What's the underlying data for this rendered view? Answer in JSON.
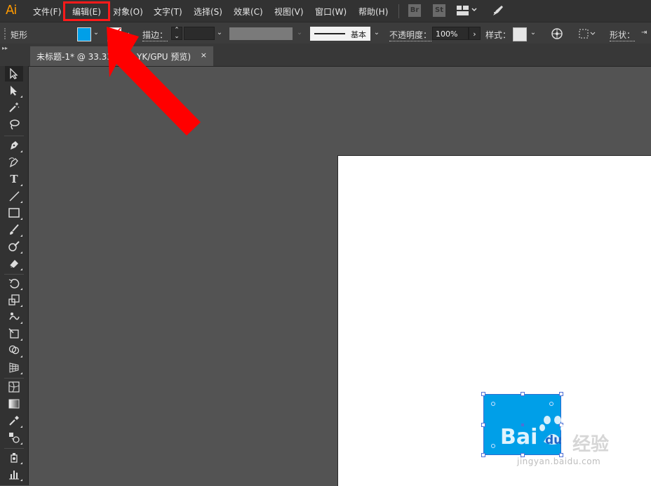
{
  "menubar": {
    "app_logo": "Ai",
    "items": [
      {
        "label": "文件(F)"
      },
      {
        "label": "编辑(E)"
      },
      {
        "label": "对象(O)"
      },
      {
        "label": "文字(T)"
      },
      {
        "label": "选择(S)"
      },
      {
        "label": "效果(C)"
      },
      {
        "label": "视图(V)"
      },
      {
        "label": "窗口(W)"
      },
      {
        "label": "帮助(H)"
      }
    ],
    "icons": {
      "bridge": "Br",
      "stock": "St"
    }
  },
  "control_bar": {
    "selection_type": "矩形",
    "fill_color": "#009fe8",
    "stroke_label": "描边：",
    "stroke_style_label": "基本",
    "opacity_label": "不透明度：",
    "opacity_value": "100%",
    "style_label": "样式：",
    "shape_label": "形状："
  },
  "document_tab": {
    "title": "未标题-1* @ 33.33",
    "title_tail": "YK/GPU 预览)",
    "close": "×"
  },
  "toolbar": {
    "tools": [
      "selection-tool",
      "direct-selection-tool",
      "magic-wand-tool",
      "lasso-tool",
      "pen-tool",
      "curvature-tool",
      "type-tool",
      "line-segment-tool",
      "rectangle-tool",
      "paintbrush-tool",
      "shaper-tool",
      "eraser-tool",
      "rotate-tool",
      "scale-tool",
      "warp-tool",
      "free-transform-tool",
      "shape-builder-tool",
      "perspective-grid-tool",
      "mesh-tool",
      "gradient-tool",
      "eyedropper-tool",
      "blend-tool",
      "symbol-sprayer-tool",
      "column-graph-tool"
    ]
  },
  "canvas": {
    "shape_color": "#009fe8",
    "watermark_brand": "Bai",
    "watermark_du": "du",
    "watermark_cn": "经验",
    "watermark_url": "jingyan.baidu.com"
  },
  "annotation": {
    "highlight_color": "#ff1a1a",
    "arrow_color": "#ff0000"
  }
}
